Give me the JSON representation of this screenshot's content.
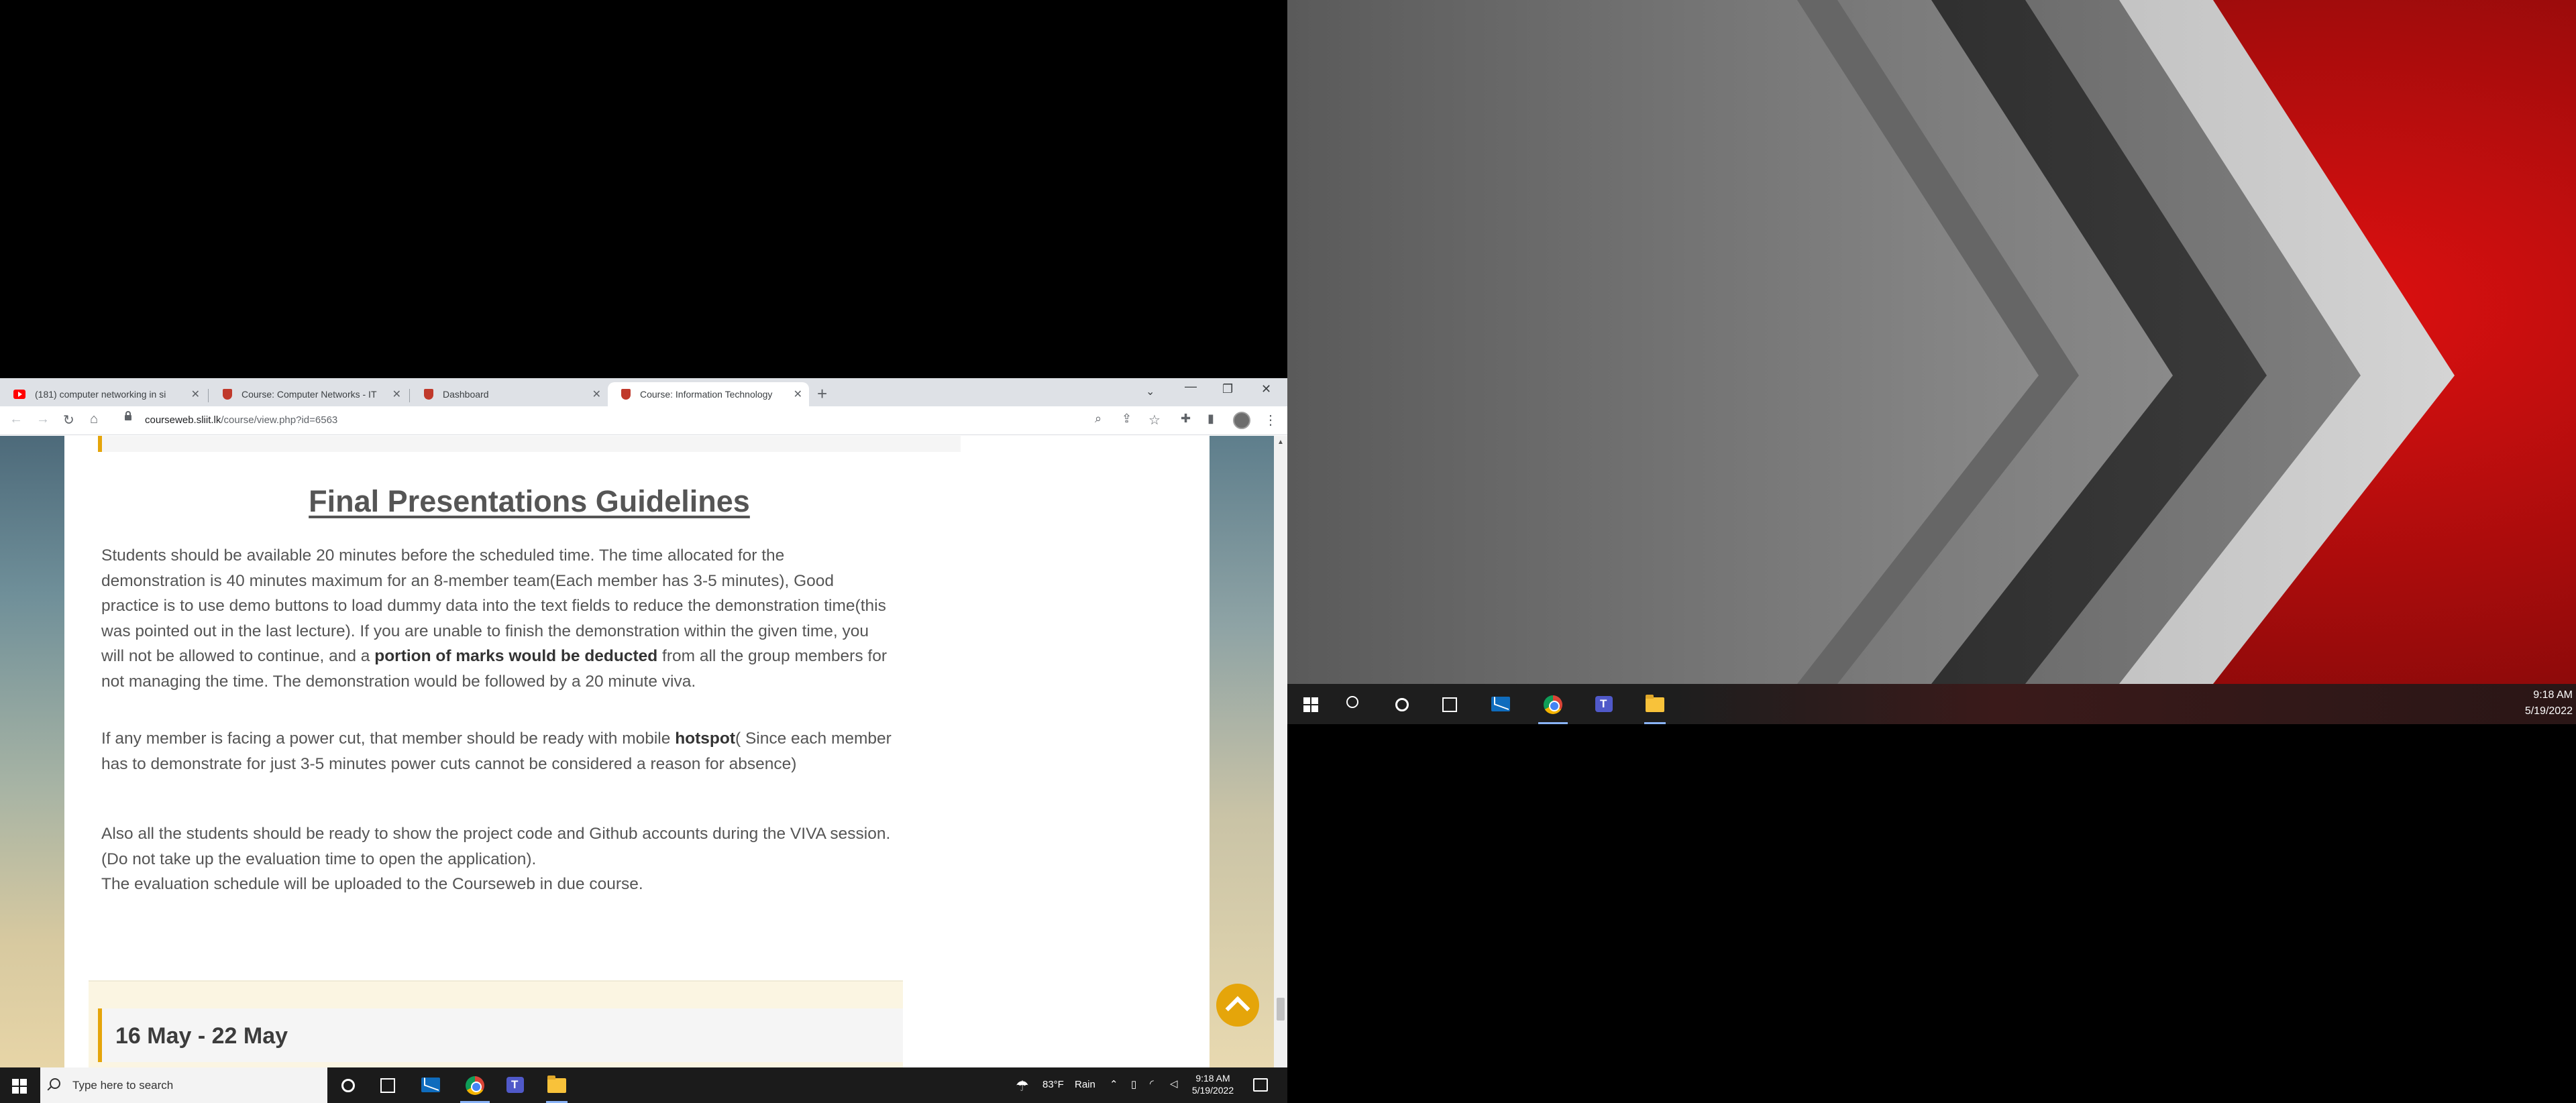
{
  "browser": {
    "tabs": [
      {
        "title": "(181) computer networking in si",
        "icon": "youtube-icon"
      },
      {
        "title": "Course: Computer Networks - IT",
        "icon": "sliit-icon"
      },
      {
        "title": "Dashboard",
        "icon": "sliit-icon"
      },
      {
        "title": "Course: Information Technology",
        "icon": "sliit-icon"
      }
    ],
    "new_tab": "+",
    "url_host": "courseweb.sliit.lk",
    "url_path": "/course/view.php?id=6563"
  },
  "page": {
    "title": "Final Presentations Guidelines",
    "para1_a": "Students should be available 20 minutes before the scheduled time. The time allocated for the demonstration is 40 minutes maximum for an 8-member team(Each member has 3-5 minutes), Good practice is to use demo buttons to load dummy data into the text fields to reduce the demonstration time(this was pointed out in the last lecture). If you are unable to finish the demonstration within the given time,  you will not be allowed to continue, and a ",
    "para1_b": "portion of marks would be deducted",
    "para1_c": " from all the group members for not managing the time. The demonstration would be followed by a 20 minute viva.",
    "para2_a": "If any member is facing a power cut, that member should be ready with mobile ",
    "para2_b": "hotspot",
    "para2_c": "( Since each member has to demonstrate for just 3-5 minutes power cuts cannot be considered a reason for absence)",
    "para3": "Also all the students should be ready to show the project code and Github accounts during the VIVA session.(Do not take up  the evaluation time to open the application).",
    "para4": "The evaluation schedule will be uploaded to the Courseweb in due course.",
    "next_week": "16 May - 22 May"
  },
  "taskbar_left": {
    "search_placeholder": "Type here to search",
    "weather_temp": "83°F",
    "weather_text": "Rain",
    "time": "9:18 AM",
    "date": "5/19/2022"
  },
  "taskbar_right": {
    "time": "9:18 AM",
    "date": "5/19/2022"
  },
  "colors": {
    "accent": "#e5a50a",
    "wallpaper_red": "#d81212"
  }
}
